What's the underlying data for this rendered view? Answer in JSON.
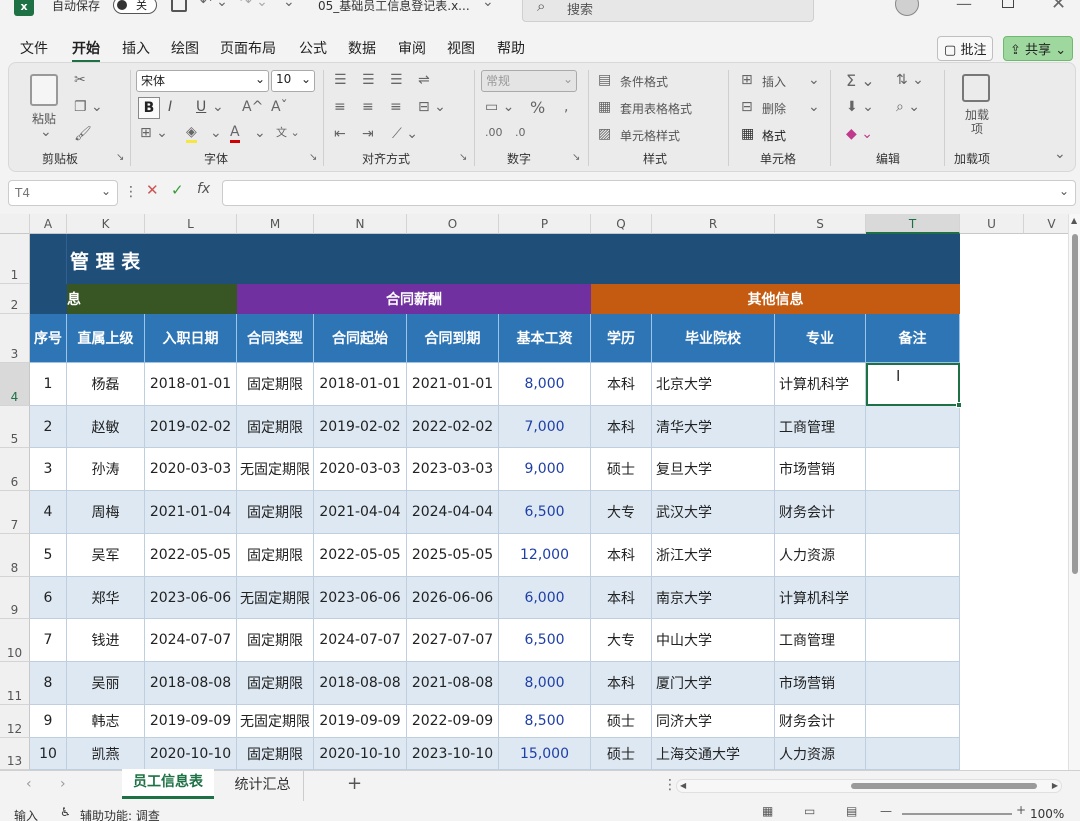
{
  "titlebar": {
    "autosave_label": "自动保存",
    "autosave_state": "关",
    "filename": "05_基础员工信息登记表.x...",
    "search_placeholder": "搜索"
  },
  "menu": [
    "文件",
    "开始",
    "插入",
    "绘图",
    "页面布局",
    "公式",
    "数据",
    "审阅",
    "视图",
    "帮助"
  ],
  "comment_button": "批注",
  "share_button": "共享",
  "ribbon": {
    "clipboard": {
      "paste": "粘贴",
      "label": "剪贴板"
    },
    "font": {
      "name": "宋体",
      "size": "10",
      "bold": "B",
      "italic": "I",
      "underline": "U",
      "label": "字体"
    },
    "alignment": {
      "label": "对齐方式"
    },
    "number": {
      "format": "常规",
      "label": "数字"
    },
    "styles": {
      "conditional": "条件格式",
      "table": "套用表格格式",
      "cell": "单元格样式",
      "label": "样式"
    },
    "cells": {
      "insert": "插入",
      "delete": "删除",
      "format": "格式",
      "label": "单元格"
    },
    "editing": {
      "label": "编辑"
    },
    "addins": {
      "button": "加载项",
      "label": "加载项"
    }
  },
  "formula_bar": {
    "name_box": "T4",
    "value": ""
  },
  "columns": [
    "A",
    "K",
    "L",
    "M",
    "N",
    "O",
    "P",
    "Q",
    "R",
    "S",
    "T",
    "U",
    "V"
  ],
  "rows": [
    "1",
    "2",
    "3",
    "4",
    "5",
    "6",
    "7",
    "8",
    "9",
    "10",
    "11",
    "12",
    "13"
  ],
  "sheet_title": "管 理 表",
  "section_headers": {
    "basic": "息",
    "contract": "合同薪酬",
    "other": "其他信息"
  },
  "table_headers": [
    "序号",
    "直属上级",
    "入职日期",
    "合同类型",
    "合同起始",
    "合同到期",
    "基本工资",
    "学历",
    "毕业院校",
    "专业",
    "备注"
  ],
  "table_rows": [
    [
      "1",
      "杨磊",
      "2018-01-01",
      "固定期限",
      "2018-01-01",
      "2021-01-01",
      "8,000",
      "本科",
      "北京大学",
      "计算机科学",
      ""
    ],
    [
      "2",
      "赵敏",
      "2019-02-02",
      "固定期限",
      "2019-02-02",
      "2022-02-02",
      "7,000",
      "本科",
      "清华大学",
      "工商管理",
      ""
    ],
    [
      "3",
      "孙涛",
      "2020-03-03",
      "无固定期限",
      "2020-03-03",
      "2023-03-03",
      "9,000",
      "硕士",
      "复旦大学",
      "市场营销",
      ""
    ],
    [
      "4",
      "周梅",
      "2021-01-04",
      "固定期限",
      "2021-04-04",
      "2024-04-04",
      "6,500",
      "大专",
      "武汉大学",
      "财务会计",
      ""
    ],
    [
      "5",
      "吴军",
      "2022-05-05",
      "固定期限",
      "2022-05-05",
      "2025-05-05",
      "12,000",
      "本科",
      "浙江大学",
      "人力资源",
      ""
    ],
    [
      "6",
      "郑华",
      "2023-06-06",
      "无固定期限",
      "2023-06-06",
      "2026-06-06",
      "6,000",
      "本科",
      "南京大学",
      "计算机科学",
      ""
    ],
    [
      "7",
      "钱进",
      "2024-07-07",
      "固定期限",
      "2024-07-07",
      "2027-07-07",
      "6,500",
      "大专",
      "中山大学",
      "工商管理",
      ""
    ],
    [
      "8",
      "吴丽",
      "2018-08-08",
      "固定期限",
      "2018-08-08",
      "2021-08-08",
      "8,000",
      "本科",
      "厦门大学",
      "市场营销",
      ""
    ],
    [
      "9",
      "韩志",
      "2019-09-09",
      "无固定期限",
      "2019-09-09",
      "2022-09-09",
      "8,500",
      "硕士",
      "同济大学",
      "财务会计",
      ""
    ],
    [
      "10",
      "凯燕",
      "2020-10-10",
      "固定期限",
      "2020-10-10",
      "2023-10-10",
      "15,000",
      "硕士",
      "上海交通大学",
      "人力资源",
      ""
    ]
  ],
  "sheet_tabs": [
    "员工信息表",
    "统计汇总"
  ],
  "add_sheet": "+",
  "status_bar": {
    "mode": "输入",
    "accessibility": "辅助功能: 调查",
    "zoom": "100%"
  },
  "colors": {
    "title_bg": "#1f4e79",
    "section_green": "#375623",
    "section_purple": "#7030a0",
    "section_orange": "#c55a11",
    "header_blue": "#2e75b6",
    "stripe": "#dde8f3"
  }
}
